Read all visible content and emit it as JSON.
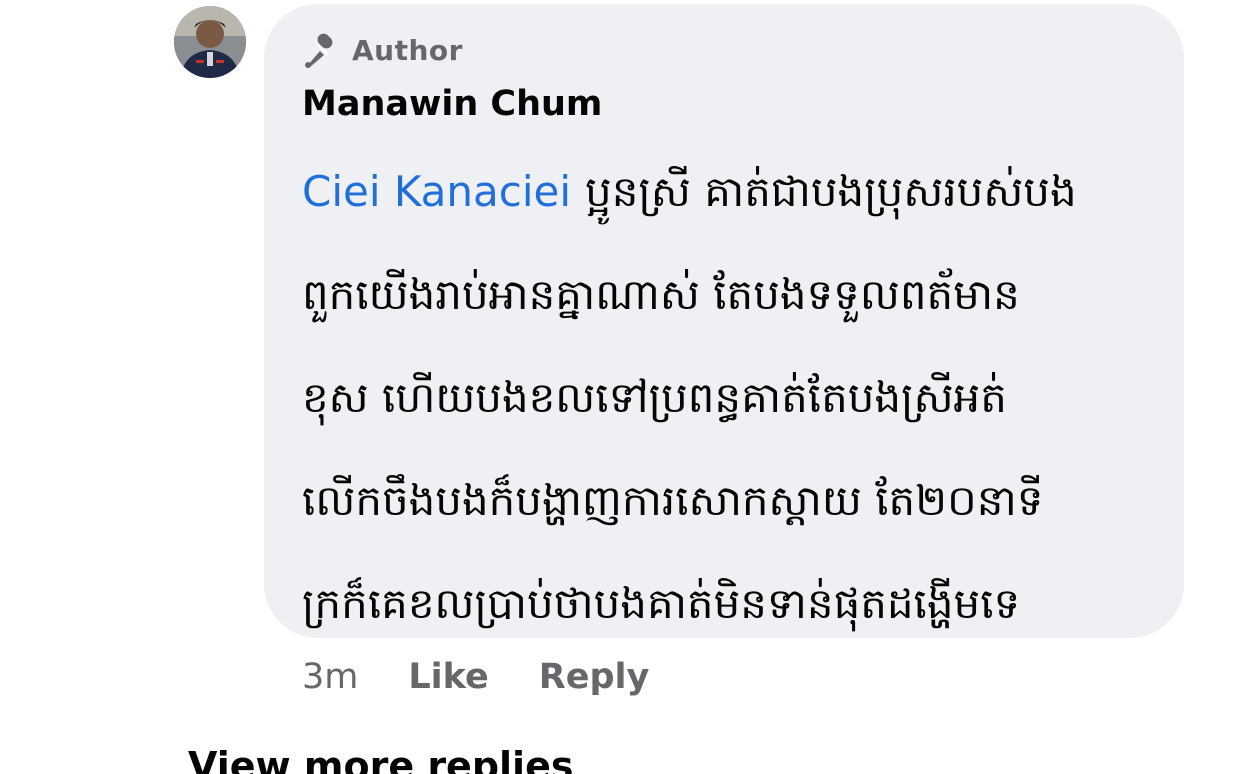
{
  "comment": {
    "badge_label": "Author",
    "badge_icon": "microphone-icon",
    "author_name": "Manawin Chum",
    "mention": "Ciei Kanaciei",
    "body_lines": [
      "ប្អូនស្រី គាត់ជាបងប្រុសរបស់បង",
      "ពួកយើងរាប់អានគ្នាណាស់ តែបងទទួលពត័មាន",
      "ខុស ហើយបងខលទៅប្រពន្ធគាត់តែបងស្រីអត់",
      "លើកចឹងបងក៏បង្ហាញការសោកស្តាយ តែ២០នាទី",
      "ក្រក៏គេខលប្រាប់ថាបងគាត់មិនទាន់ផុតដង្ហើមទេ"
    ],
    "time": "3m",
    "like_label": "Like",
    "reply_label": "Reply"
  },
  "view_more_label": "View more replies",
  "colors": {
    "bubble": "#eef0f4",
    "mention": "#216fdb",
    "meta": "#65676b",
    "text": "#050505"
  }
}
